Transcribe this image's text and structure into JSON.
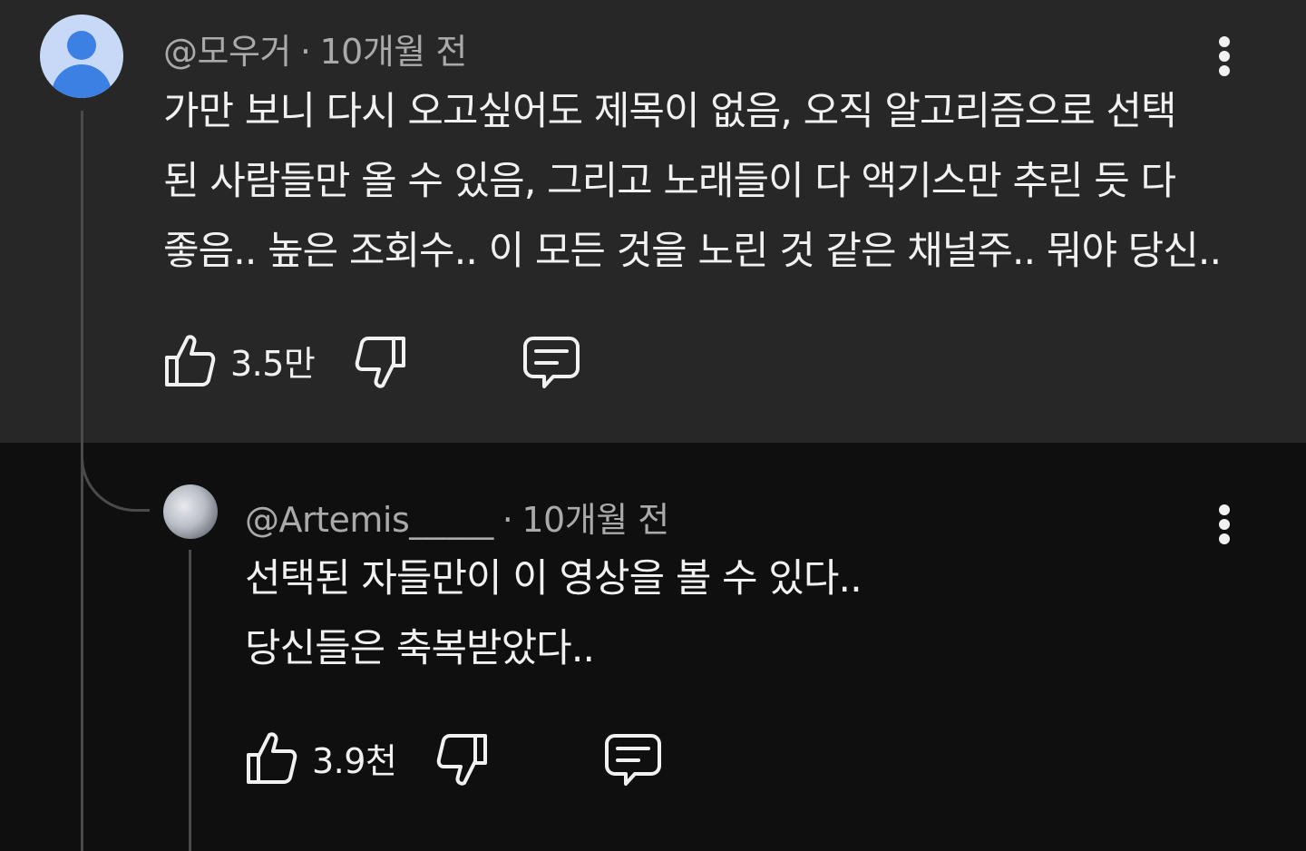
{
  "comments": [
    {
      "author": "@모우거",
      "separator": "·",
      "time": "10개월 전",
      "lines": [
        "가만 보니 다시 오고싶어도 제목이 없음, 오직 알고리즘으로 선택",
        "된 사람들만 올 수 있음, 그리고 노래들이 다 액기스만 추린 듯 다",
        "좋음.. 높은 조회수.. 이 모든 것을 노린 것 같은 채널주.. 뭐야 당신.."
      ],
      "like_count": "3.5만",
      "icons": {
        "like": "thumbs-up-icon",
        "dislike": "thumbs-down-icon",
        "reply": "comment-icon",
        "more": "more-vertical-icon",
        "avatar": "default-user-avatar"
      }
    },
    {
      "author": "@Artemis_____",
      "separator": "·",
      "time": "10개월 전",
      "lines": [
        "선택된 자들만이 이 영상을 볼 수 있다..",
        "당신들은 축복받았다.."
      ],
      "like_count": "3.9천",
      "icons": {
        "like": "thumbs-up-icon",
        "dislike": "thumbs-down-icon",
        "reply": "comment-icon",
        "more": "more-vertical-icon",
        "avatar": "moon-avatar"
      }
    }
  ],
  "colors": {
    "highlight_background": "#272727",
    "page_background": "#0f0f0f",
    "text_primary": "#f1f1f1",
    "text_secondary": "#aaaaaa",
    "avatar_blue": "#3d80e4"
  }
}
